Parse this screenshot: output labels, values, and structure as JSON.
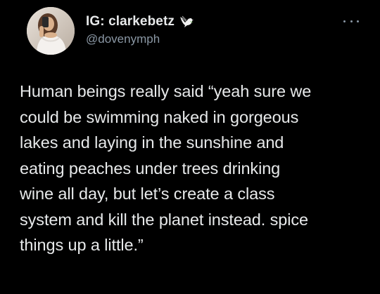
{
  "tweet": {
    "author": {
      "display_name": "IG: clarkebetz",
      "badge_icon": "dove-icon",
      "handle": "@dovenymph",
      "avatar": "profile-photo"
    },
    "menu_icon": "more-dots-icon",
    "text_lines": [
      "Human beings really said “yeah sure we",
      "could be swimming naked in gorgeous",
      "lakes and laying in the sunshine and",
      "eating peaches under trees drinking",
      "wine all day, but let’s create a class",
      "system and kill the planet instead. spice",
      "things up a little.”"
    ]
  },
  "colors": {
    "background": "#000000",
    "text": "#e7e9ea",
    "secondary_text": "#8b98a5"
  }
}
